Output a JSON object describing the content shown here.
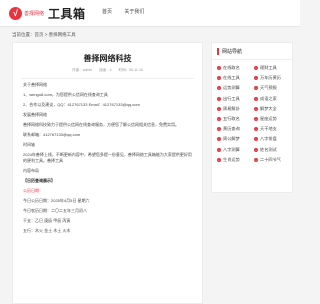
{
  "header": {
    "logo_glyph": "√",
    "logo_small": "善择网络",
    "logo_big": "工具箱",
    "nav": [
      "首页",
      "关于我们"
    ]
  },
  "breadcrumb": "当前位置：首页 > 善择网络工具",
  "article": {
    "title": "善择网络科技",
    "meta": {
      "author": "作者：admin",
      "views": "阅读：4",
      "date": "时间：06-11-16"
    },
    "paragraphs": [
      "关于善择网络",
      "1、wengu8.com，为您提供公信网在线查询工具",
      "2、合作以及建议，QQ：412767133 Email：412767133@qq.com",
      "发展善择网络",
      "善择网络科技致力于提供公信网在线查询服务，方便您了解公信网相关信息，免费实用。",
      "联系邮箱：412767133@qq.com",
      "时间轴",
      "2024年善择上线，不断更新内容中，希望您多提一份意见，善择网络工具箱能为大家提供更好用的便利工具。善择工具",
      "内容布局",
      "【日历查询展示】",
      "公历日期：",
      "今日公历日期：2025年4月5日 星期六",
      "今日农历日期：二〇二五年三月初八",
      "干支：乙巳  庚辰  甲辰  丙寅",
      "五行：木火  金土  木土  火木"
    ]
  },
  "sidebar": {
    "heading": "网站导航",
    "items": [
      "在线取名",
      "理财工具",
      "在线工具",
      "万年历黄历",
      "运势测算",
      "天气预报",
      "出行工具",
      "成语之家",
      "周易解卦",
      "解梦大全",
      "五行取名",
      "星座运势",
      "黄历查询",
      "天干地支",
      "周公解梦",
      "八字排盘",
      "八字测算",
      "姓名测试",
      "生肖运势",
      "二十四节气"
    ]
  },
  "colors": {
    "accent": "#e7343f",
    "page_bg": "#f4f4f4",
    "card_bg": "#ffffff"
  }
}
